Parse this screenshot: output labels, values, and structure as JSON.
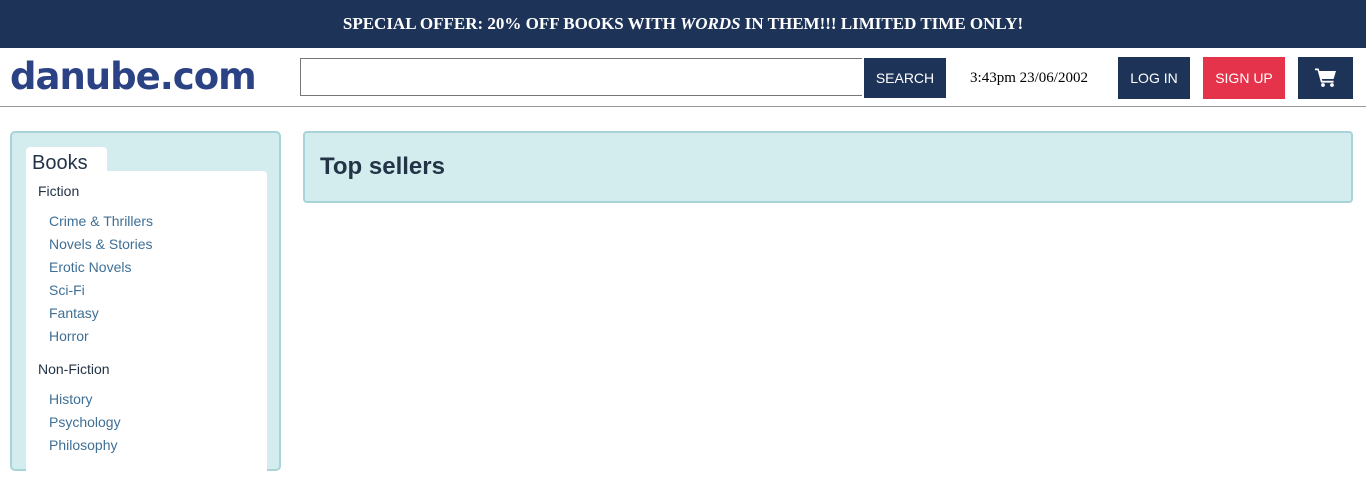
{
  "banner": {
    "prefix": "SPECIAL OFFER: 20% OFF BOOKS WITH ",
    "emphasis": "WORDS",
    "suffix": " IN THEM!!! LIMITED TIME ONLY!"
  },
  "header": {
    "logo": "danube.com",
    "search_value": "",
    "search_button": "SEARCH",
    "clock": "3:43pm 23/06/2002",
    "login_label": "LOG IN",
    "signup_label": "SIGN UP",
    "cart_icon": "shopping-cart-icon"
  },
  "sidebar": {
    "title": "Books",
    "fiction": {
      "heading": "Fiction",
      "items": [
        "Crime & Thrillers",
        "Novels & Stories",
        "Erotic Novels",
        "Sci-Fi",
        "Fantasy",
        "Horror"
      ]
    },
    "nonfiction": {
      "heading": "Non-Fiction",
      "items": [
        "History",
        "Psychology",
        "Philosophy"
      ]
    }
  },
  "main": {
    "title": "Top sellers"
  },
  "colors": {
    "navy": "#1e3358",
    "signup_red": "#e4334a",
    "panel_bg": "#d3ecee",
    "link": "#3f6f95"
  }
}
